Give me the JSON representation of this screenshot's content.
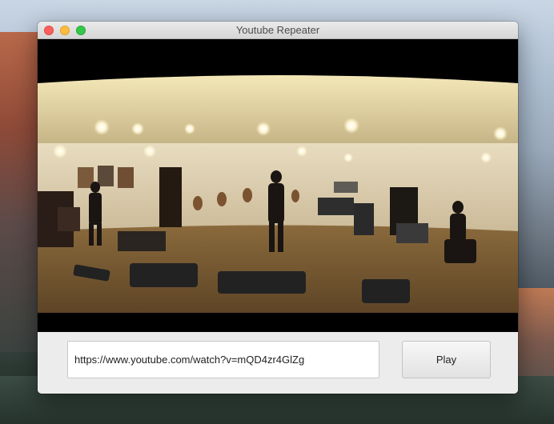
{
  "window": {
    "title": "Youtube Repeater"
  },
  "video": {
    "description_icon": "video-frame"
  },
  "controls": {
    "url_value": "https://www.youtube.com/watch?v=mQD4zr4GlZg",
    "play_label": "Play"
  },
  "colors": {
    "close": "#fc605c",
    "minimize": "#fdbc40",
    "maximize": "#34c84a"
  }
}
